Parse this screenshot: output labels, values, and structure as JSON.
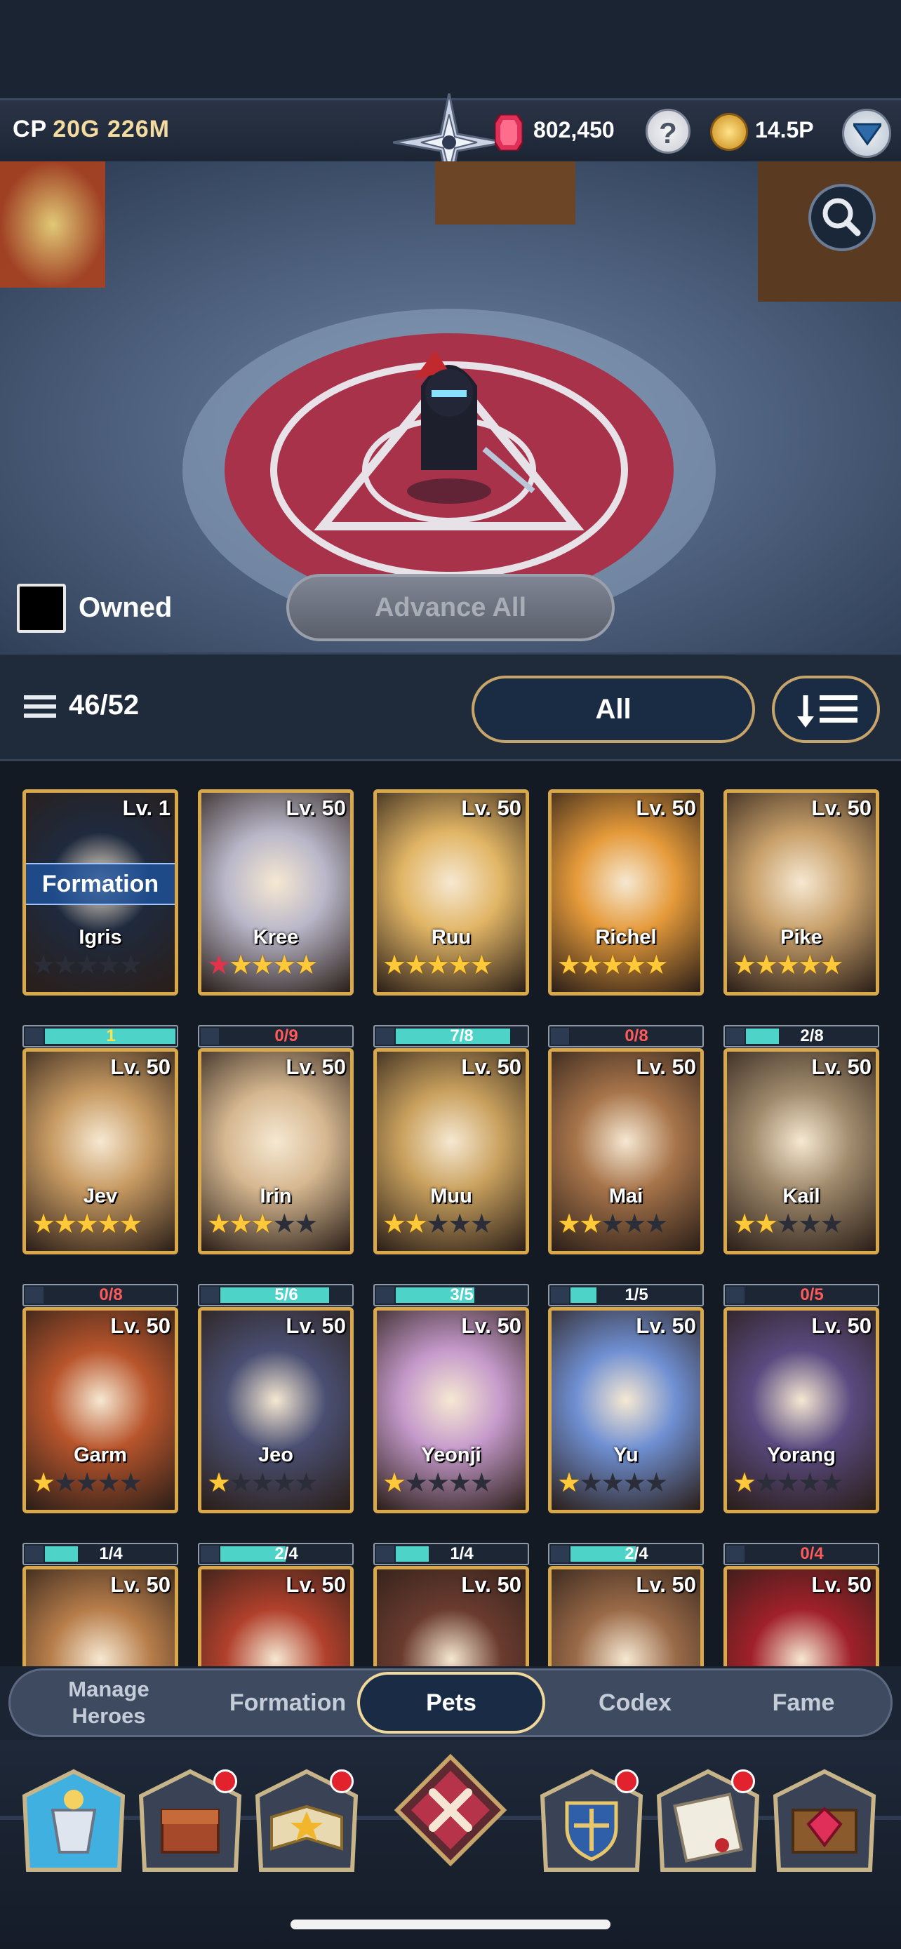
{
  "header": {
    "cp_label": "CP",
    "cp_value": "20G 226M",
    "gems": "802,450",
    "help_label": "?",
    "gold": "14.5P",
    "icons": [
      "compass-emblem-icon",
      "ruby-gem-icon",
      "help-icon",
      "gold-coin-icon",
      "chevron-down-icon"
    ]
  },
  "scene": {
    "owned_label": "Owned",
    "advance_all_label": "Advance All",
    "icons": [
      "search-icon"
    ]
  },
  "filter": {
    "count": "46/52",
    "filter_label": "All",
    "icons": [
      "list-icon",
      "sort-icon"
    ]
  },
  "pets": [
    {
      "name": "Igris",
      "level": "Lv. 1",
      "stars": 0,
      "red_stars": 0,
      "progress": "1",
      "fill": 1.0,
      "formation": "Formation",
      "color": "#1f2a3e"
    },
    {
      "name": "Kree",
      "level": "Lv. 50",
      "stars": 5,
      "red_stars": 1,
      "progress": "0/9",
      "fill": 0.0,
      "color": "#b9b7c9"
    },
    {
      "name": "Ruu",
      "level": "Lv. 50",
      "stars": 5,
      "red_stars": 0,
      "progress": "7/8",
      "fill": 0.875,
      "color": "#e1b565"
    },
    {
      "name": "Richel",
      "level": "Lv. 50",
      "stars": 5,
      "red_stars": 0,
      "progress": "0/8",
      "fill": 0.0,
      "color": "#e59a3a"
    },
    {
      "name": "Pike",
      "level": "Lv. 50",
      "stars": 5,
      "red_stars": 0,
      "progress": "2/8",
      "fill": 0.25,
      "color": "#c8a06a"
    },
    {
      "name": "Jev",
      "level": "Lv. 50",
      "stars": 5,
      "red_stars": 0,
      "progress": "0/8",
      "fill": 0.0,
      "color": "#c79a62"
    },
    {
      "name": "Irin",
      "level": "Lv. 50",
      "stars": 3,
      "red_stars": 0,
      "progress": "5/6",
      "fill": 0.833,
      "color": "#d6b891"
    },
    {
      "name": "Muu",
      "level": "Lv. 50",
      "stars": 2,
      "red_stars": 0,
      "progress": "3/5",
      "fill": 0.6,
      "color": "#c9a15e"
    },
    {
      "name": "Mai",
      "level": "Lv. 50",
      "stars": 2,
      "red_stars": 0,
      "progress": "1/5",
      "fill": 0.2,
      "color": "#a7744a"
    },
    {
      "name": "Kail",
      "level": "Lv. 50",
      "stars": 2,
      "red_stars": 0,
      "progress": "0/5",
      "fill": 0.0,
      "color": "#a08a6c"
    },
    {
      "name": "Garm",
      "level": "Lv. 50",
      "stars": 1,
      "red_stars": 0,
      "progress": "1/4",
      "fill": 0.25,
      "color": "#b8552c"
    },
    {
      "name": "Jeo",
      "level": "Lv. 50",
      "stars": 1,
      "red_stars": 0,
      "progress": "2/4",
      "fill": 0.5,
      "color": "#4a4f72"
    },
    {
      "name": "Yeonji",
      "level": "Lv. 50",
      "stars": 1,
      "red_stars": 0,
      "progress": "1/4",
      "fill": 0.25,
      "color": "#c59acb"
    },
    {
      "name": "Yu",
      "level": "Lv. 50",
      "stars": 1,
      "red_stars": 0,
      "progress": "2/4",
      "fill": 0.5,
      "color": "#6f8fd2"
    },
    {
      "name": "Yorang",
      "level": "Lv. 50",
      "stars": 1,
      "red_stars": 0,
      "progress": "0/4",
      "fill": 0.0,
      "color": "#5a4a80"
    },
    {
      "name": "",
      "level": "Lv. 50",
      "stars": 0,
      "red_stars": 0,
      "progress": "",
      "fill": 0.0,
      "color": "#b77d4a"
    },
    {
      "name": "",
      "level": "Lv. 50",
      "stars": 0,
      "red_stars": 0,
      "progress": "",
      "fill": 0.0,
      "color": "#b0402c"
    },
    {
      "name": "",
      "level": "Lv. 50",
      "stars": 0,
      "red_stars": 0,
      "progress": "",
      "fill": 0.0,
      "color": "#6a3b2f"
    },
    {
      "name": "",
      "level": "Lv. 50",
      "stars": 0,
      "red_stars": 0,
      "progress": "",
      "fill": 0.0,
      "color": "#9a6a48"
    },
    {
      "name": "",
      "level": "Lv. 50",
      "stars": 0,
      "red_stars": 0,
      "progress": "",
      "fill": 0.0,
      "color": "#a0202a"
    }
  ],
  "tabs": {
    "manage_line1": "Manage",
    "manage_line2": "Heroes",
    "formation": "Formation",
    "pets": "Pets",
    "codex": "Codex",
    "fame": "Fame",
    "active": "Pets"
  },
  "dock": {
    "icons": [
      "armor-icon",
      "treasure-chest-icon",
      "spellbook-icon",
      "close-icon",
      "guild-shield-icon",
      "quest-scroll-icon",
      "gem-shop-icon"
    ],
    "badges": [
      false,
      true,
      true,
      false,
      true,
      true,
      false
    ]
  },
  "colors": {
    "accent_gold": "#d9a84a",
    "progress_teal": "#4ed3c9",
    "progress_red_text": "#ff5a5a",
    "badge_red": "#e2232e"
  }
}
